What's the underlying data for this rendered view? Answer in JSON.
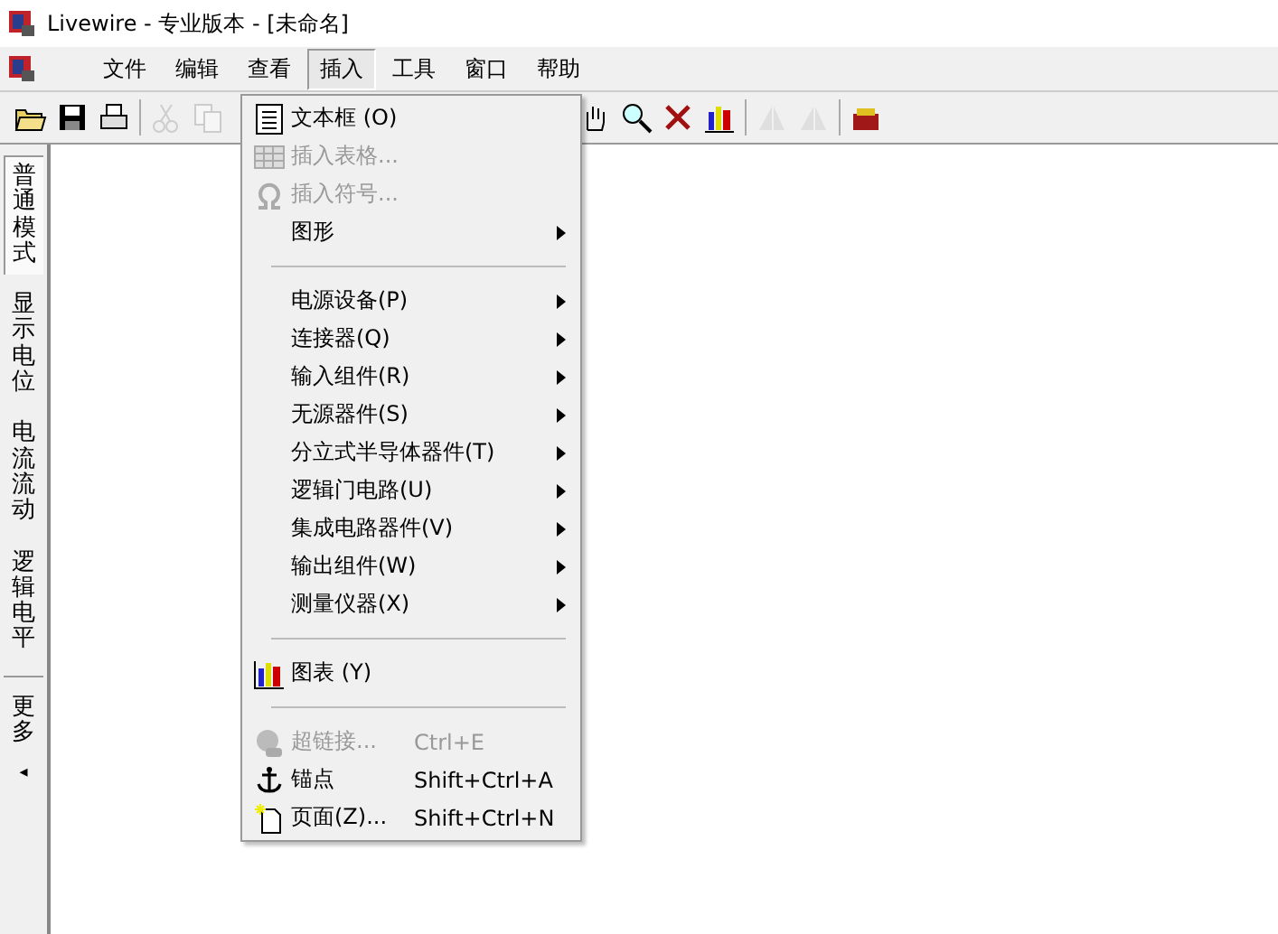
{
  "window": {
    "title": "Livewire - 专业版本 - [未命名]"
  },
  "menu_bar": [
    {
      "label": "文件",
      "selected": false
    },
    {
      "label": "编辑",
      "selected": false
    },
    {
      "label": "查看",
      "selected": false
    },
    {
      "label": "插入",
      "selected": true
    },
    {
      "label": "工具",
      "selected": false
    },
    {
      "label": "窗口",
      "selected": false
    },
    {
      "label": "帮助",
      "selected": false
    }
  ],
  "toolbar": [
    {
      "disabled": false
    },
    {
      "disabled": false
    },
    {
      "disabled": false
    },
    {
      "disabled": true
    },
    {
      "disabled": true
    },
    {
      "disabled": false
    },
    {
      "disabled": false
    },
    {
      "disabled": false
    },
    {
      "disabled": false
    },
    {
      "disabled": true
    },
    {
      "disabled": true
    },
    {
      "disabled": false
    }
  ],
  "sidebar": {
    "tabs": [
      {
        "label": "普通模式",
        "selected": true
      },
      {
        "label": "显示电位",
        "selected": false
      },
      {
        "label": "电流流动",
        "selected": false
      },
      {
        "label": "逻辑电平",
        "selected": false
      }
    ],
    "more": {
      "label": "更多",
      "arrow": "◂"
    }
  },
  "insert_menu": [
    {
      "kind": "item",
      "label": "文本框  (O)",
      "disabled": false,
      "submenu": false
    },
    {
      "kind": "item",
      "label": "插入表格...",
      "disabled": true,
      "submenu": false
    },
    {
      "kind": "item",
      "label": "插入符号...",
      "disabled": true,
      "submenu": false
    },
    {
      "kind": "item",
      "label": "图形",
      "disabled": false,
      "submenu": true
    },
    {
      "kind": "separator"
    },
    {
      "kind": "item",
      "label": "电源设备(P)",
      "disabled": false,
      "submenu": true
    },
    {
      "kind": "item",
      "label": "连接器(Q)",
      "disabled": false,
      "submenu": true
    },
    {
      "kind": "item",
      "label": "输入组件(R)",
      "disabled": false,
      "submenu": true
    },
    {
      "kind": "item",
      "label": "无源器件(S)",
      "disabled": false,
      "submenu": true
    },
    {
      "kind": "item",
      "label": "分立式半导体器件(T)",
      "disabled": false,
      "submenu": true
    },
    {
      "kind": "item",
      "label": "逻辑门电路(U)",
      "disabled": false,
      "submenu": true
    },
    {
      "kind": "item",
      "label": "集成电路器件(V)",
      "disabled": false,
      "submenu": true
    },
    {
      "kind": "item",
      "label": "输出组件(W)",
      "disabled": false,
      "submenu": true
    },
    {
      "kind": "item",
      "label": "测量仪器(X)",
      "disabled": false,
      "submenu": true
    },
    {
      "kind": "separator"
    },
    {
      "kind": "item",
      "label": "图表 (Y)",
      "disabled": false,
      "submenu": false
    },
    {
      "kind": "separator"
    },
    {
      "kind": "item",
      "label": "超链接...",
      "shortcut": "Ctrl+E",
      "disabled": true,
      "submenu": false
    },
    {
      "kind": "item",
      "label": "锚点",
      "shortcut": "Shift+Ctrl+A",
      "disabled": false,
      "submenu": false
    },
    {
      "kind": "item",
      "label": "页面(Z)...",
      "shortcut": "Shift+Ctrl+N",
      "disabled": false,
      "submenu": false
    }
  ]
}
